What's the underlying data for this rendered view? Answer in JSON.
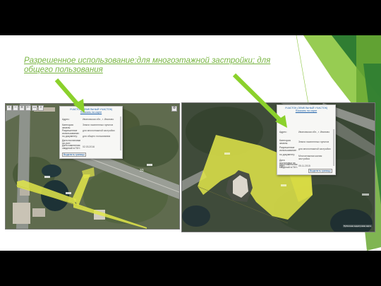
{
  "slide": {
    "title": "Разрешенное использование:для многоэтажной застройки; для общего пользования"
  },
  "left_map": {
    "popup": {
      "header": "УЧАСТОК (ЗЕМЕЛЬНЫЙ УЧАСТОК)",
      "header_link": "Показать на карте",
      "rows": [
        "Адрес:",
        "Категория земель:",
        "Разрешенное использование:",
        "по документу:",
        "Дата постановки на учет:",
        "Дата изменения сведений в ГКН:"
      ],
      "values": [
        "Ивановская обл., г. Иваново",
        "Земли населенных пунктов",
        "для многоэтажной застройки",
        "для общего пользования",
        "",
        "02.03.2016"
      ],
      "button": "Выделить границы"
    },
    "label_number": "33"
  },
  "right_map": {
    "popup": {
      "header": "УЧАСТОК (ЗЕМЕЛЬНЫЙ УЧАСТОК)",
      "header_link": "Показать на карте",
      "rows": [
        "Адрес:",
        "Категория земель:",
        "Разрешенное использование:",
        "по документу:",
        "Дата постановки на учет:",
        "Дата изменения сведений в ГКН:"
      ],
      "values": [
        "Ивановская обл., г. Иваново",
        "Земли населенных пунктов",
        "для многоэтажной застройки",
        "Многоэтажная жилая застройка",
        "",
        "05.11.2015"
      ],
      "button": "Выделить границы"
    },
    "footer_text": "Публичная кадастровая карта"
  },
  "colors": {
    "title": "#79b543",
    "accent_dark": "#2f7d32",
    "accent_light": "#8cc63f",
    "arrow": "#8bd12c",
    "highlight": "#e2e64a"
  }
}
